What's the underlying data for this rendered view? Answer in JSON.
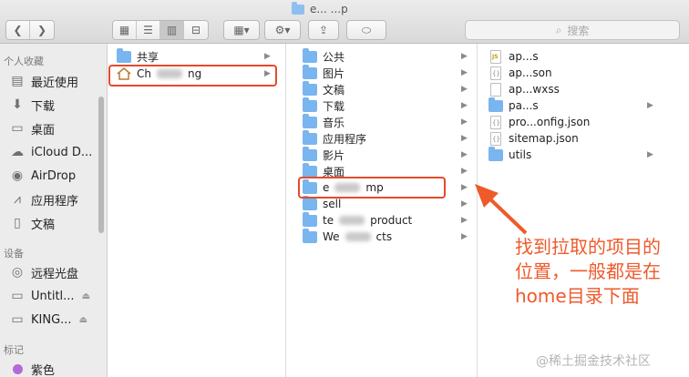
{
  "window": {
    "title": "e... ...p"
  },
  "toolbar": {
    "back_icon": "chevron-left-icon",
    "forward_icon": "chevron-right-icon",
    "search_placeholder": "搜索"
  },
  "sidebar": {
    "favorites_header": "个人收藏",
    "favorites": [
      {
        "label": "最近使用",
        "icon": "recent-icon"
      },
      {
        "label": "下载",
        "icon": "download-icon"
      },
      {
        "label": "桌面",
        "icon": "desktop-icon"
      },
      {
        "label": "iCloud D...",
        "icon": "cloud-icon"
      },
      {
        "label": "AirDrop",
        "icon": "airdrop-icon"
      },
      {
        "label": "应用程序",
        "icon": "applications-icon"
      },
      {
        "label": "文稿",
        "icon": "documents-icon"
      }
    ],
    "devices_header": "设备",
    "devices": [
      {
        "label": "远程光盘",
        "icon": "disc-icon"
      },
      {
        "label": "Untitl...",
        "icon": "drive-icon"
      },
      {
        "label": "KING...",
        "icon": "drive-icon"
      }
    ],
    "tags_header": "标记",
    "tags": [
      {
        "label": "紫色",
        "color": "#b36ad6"
      }
    ]
  },
  "columns": [
    {
      "items": [
        {
          "label": "共享"
        },
        {
          "label_start": "Ch",
          "label_end": "ng",
          "selected": true
        }
      ]
    },
    {
      "items": [
        {
          "label": "公共"
        },
        {
          "label": "图片"
        },
        {
          "label": "文稿"
        },
        {
          "label": "下载"
        },
        {
          "label": "音乐"
        },
        {
          "label": "应用程序"
        },
        {
          "label": "影片"
        },
        {
          "label": "桌面"
        },
        {
          "label_start": "e",
          "label_end": "mp",
          "selected": true
        },
        {
          "label": "sell"
        },
        {
          "label_start": "te",
          "label_end": "product"
        },
        {
          "label_start": "We",
          "label_end": "cts"
        }
      ]
    },
    {
      "items": [
        {
          "label": "ap...s"
        },
        {
          "label": "ap...son"
        },
        {
          "label": "ap...wxss"
        },
        {
          "label": "pa...s"
        },
        {
          "label": "pro...onfig.json"
        },
        {
          "label": "sitemap.json"
        },
        {
          "label": "utils"
        }
      ]
    }
  ],
  "annotation": {
    "lines": [
      "找到拉取的项目的",
      "位置，一般都是在",
      "home目录下面"
    ],
    "color": "#ef5a2b"
  },
  "watermark": "@稀土掘金技术社区"
}
